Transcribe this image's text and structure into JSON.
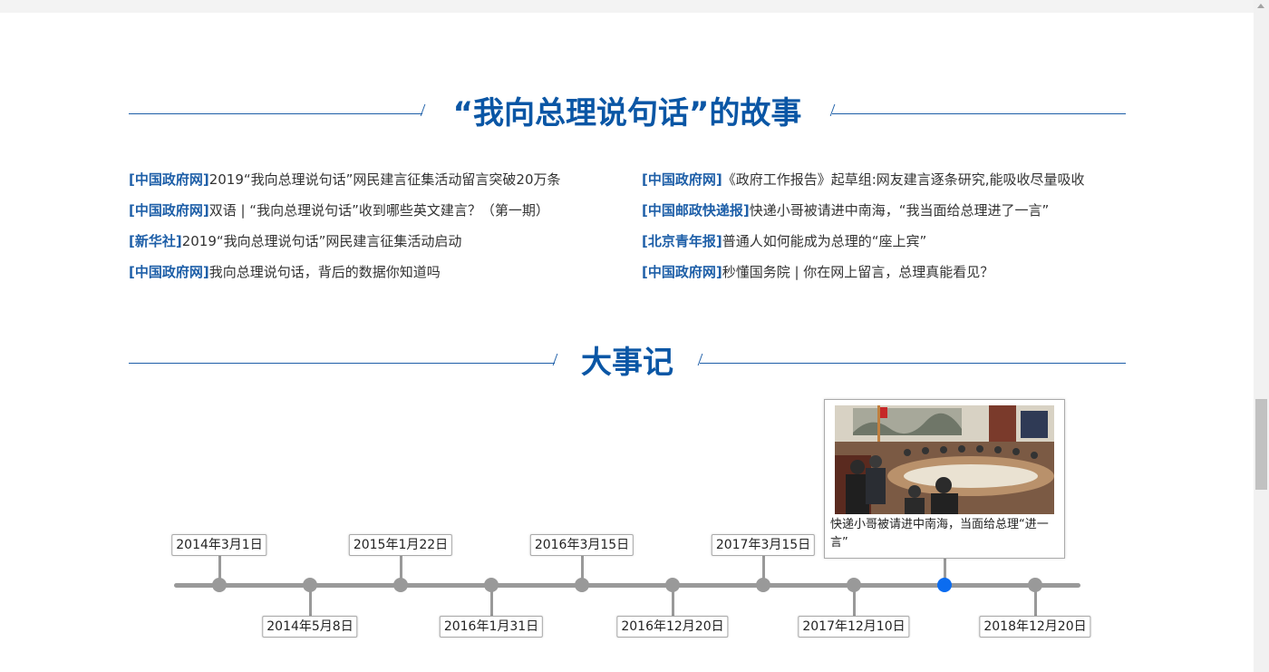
{
  "section_story": {
    "title": "“我向总理说句话”的故事"
  },
  "news": {
    "left": [
      {
        "source": "[中国政府网]",
        "text": "2019“我向总理说句话”网民建言征集活动留言突破20万条"
      },
      {
        "source": "[中国政府网]",
        "text": "双语 | “我向总理说句话”收到哪些英文建言？（第一期）"
      },
      {
        "source": "[新华社]",
        "text": "2019“我向总理说句话”网民建言征集活动启动"
      },
      {
        "source": "[中国政府网]",
        "text": "我向总理说句话，背后的数据你知道吗"
      }
    ],
    "right": [
      {
        "source": "[中国政府网]",
        "text": "《政府工作报告》起草组:网友建言逐条研究,能吸收尽量吸收"
      },
      {
        "source": "[中国邮政快递报]",
        "text": "快递小哥被请进中南海，“我当面给总理进了一言”"
      },
      {
        "source": "[北京青年报]",
        "text": "普通人如何能成为总理的“座上宾”"
      },
      {
        "source": "[中国政府网]",
        "text": "秒懂国务院 | 你在网上留言，总理真能看见？"
      }
    ]
  },
  "section_events": {
    "title": "大事记"
  },
  "timeline": {
    "events": [
      {
        "date": "2014年3月1日"
      },
      {
        "date": "2014年5月8日"
      },
      {
        "date": "2015年1月22日"
      },
      {
        "date": "2016年1月31日"
      },
      {
        "date": "2016年3月15日"
      },
      {
        "date": "2016年12月20日"
      },
      {
        "date": "2017年3月15日"
      },
      {
        "date": "2017年12月10日"
      },
      {
        "date": ""
      },
      {
        "date": "2018年12月20日"
      }
    ],
    "active_index": 8,
    "popup": {
      "caption": "快递小哥被请进中南海，当面给总理“进一言”"
    }
  },
  "colors": {
    "accent_blue": "#0a56a5",
    "source_blue": "#1e5fa8",
    "axis_gray": "#999999",
    "active_dot": "#0b6cf0"
  },
  "icons": {
    "scroll_up": "scroll-up-arrow-icon"
  }
}
